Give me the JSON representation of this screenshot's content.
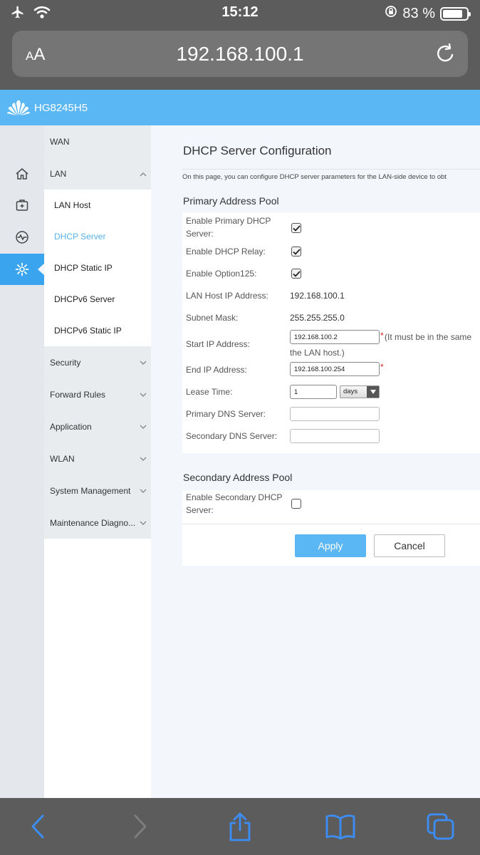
{
  "status_bar": {
    "time": "15:12",
    "battery_percent": "83 %",
    "battery_level": 0.83
  },
  "browser": {
    "aa_small": "A",
    "aa_large": "A",
    "url": "192.168.100.1"
  },
  "router": {
    "model": "HG8245H5"
  },
  "nav": {
    "top_group": "WAN",
    "lan_group": "LAN",
    "lan_items": [
      "LAN Host",
      "DHCP Server",
      "DHCP Static IP",
      "DHCPv6 Server",
      "DHCPv6 Static IP"
    ],
    "active_item": "DHCP Server",
    "groups": [
      "Security",
      "Forward Rules",
      "Application",
      "WLAN",
      "System Management",
      "Maintenance Diagno..."
    ]
  },
  "page": {
    "title": "DHCP Server Configuration",
    "description": "On this page, you can configure DHCP server parameters for the LAN-side device to obt"
  },
  "primary_pool": {
    "title": "Primary Address Pool",
    "enable_primary_label": "Enable Primary DHCP Server:",
    "enable_primary_checked": true,
    "enable_relay_label": "Enable DHCP Relay:",
    "enable_relay_checked": true,
    "enable_option125_label": "Enable Option125:",
    "enable_option125_checked": true,
    "lan_host_ip_label": "LAN Host IP Address:",
    "lan_host_ip": "192.168.100.1",
    "subnet_mask_label": "Subnet Mask:",
    "subnet_mask": "255.255.255.0",
    "start_ip_label": "Start IP Address:",
    "start_ip": "192.168.100.2",
    "start_ip_note_1": "(It must be in the same",
    "start_ip_note_2": "the LAN host.)",
    "end_ip_label": "End IP Address:",
    "end_ip": "192.168.100.254",
    "required_mark": "*",
    "lease_time_label": "Lease Time:",
    "lease_time": "1",
    "lease_unit": "days",
    "primary_dns_label": "Primary DNS Server:",
    "primary_dns": "",
    "secondary_dns_label": "Secondary DNS Server:",
    "secondary_dns": ""
  },
  "secondary_pool": {
    "title": "Secondary Address Pool",
    "enable_secondary_label": "Enable Secondary DHCP Server:",
    "enable_secondary_checked": false
  },
  "buttons": {
    "apply": "Apply",
    "cancel": "Cancel"
  },
  "colors": {
    "accent": "#5bb7f4",
    "rail_active": "#3aa5ee",
    "active_link": "#56b1e8",
    "toolbar_blue": "#3b8ef7"
  }
}
